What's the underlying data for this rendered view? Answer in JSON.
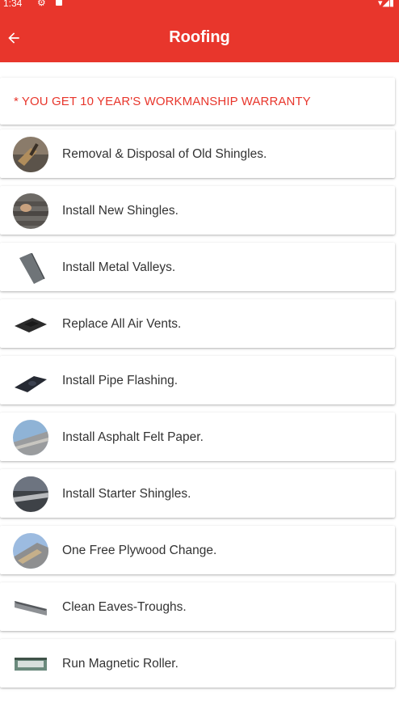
{
  "status_bar": {
    "time": "1:34"
  },
  "appbar": {
    "title": "Roofing",
    "color": "#e8362c"
  },
  "warranty_text": "* YOU GET 10 YEAR'S WORKMANSHIP WARRANTY",
  "items": [
    {
      "label": "Removal & Disposal of Old Shingles.",
      "icon": "shingle-removal-photo"
    },
    {
      "label": "Install New Shingles.",
      "icon": "new-shingles-photo"
    },
    {
      "label": "Install Metal Valleys.",
      "icon": "metal-valley-photo"
    },
    {
      "label": "Replace All Air Vents.",
      "icon": "air-vent-photo"
    },
    {
      "label": "Install Pipe Flashing.",
      "icon": "pipe-flashing-photo"
    },
    {
      "label": "Install Asphalt Felt Paper.",
      "icon": "felt-paper-photo"
    },
    {
      "label": "Install Starter Shingles.",
      "icon": "starter-shingles-photo"
    },
    {
      "label": "One Free Plywood Change.",
      "icon": "plywood-photo"
    },
    {
      "label": "Clean Eaves-Troughs.",
      "icon": "eaves-trough-photo"
    },
    {
      "label": "Run Magnetic Roller.",
      "icon": "magnetic-roller-photo"
    }
  ]
}
